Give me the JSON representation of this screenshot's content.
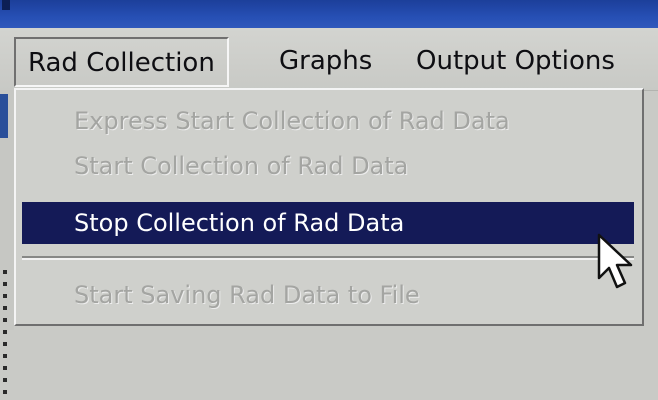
{
  "menubar": {
    "items": [
      {
        "label": "Rad Collection",
        "open": true
      },
      {
        "label": "Graphs"
      },
      {
        "label": "Output Options"
      }
    ]
  },
  "dropdown": {
    "items": [
      {
        "label": "Express Start Collection of Rad Data",
        "state": "disabled"
      },
      {
        "label": "Start Collection of Rad Data",
        "state": "disabled"
      },
      {
        "label": "Stop Collection of Rad Data",
        "state": "selected"
      },
      {
        "label": "Start Saving Rad Data to File",
        "state": "disabled"
      }
    ]
  },
  "cursor": {
    "icon": "arrow-pointer-icon"
  },
  "colors": {
    "highlight": "#141a57",
    "menu_bg": "#cfd0cc",
    "disabled_text": "#a4a5a2",
    "title_bar": "#264fb4"
  }
}
